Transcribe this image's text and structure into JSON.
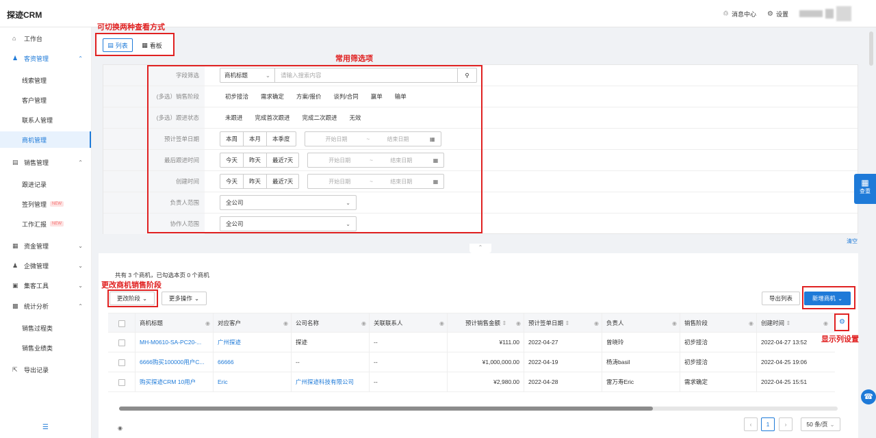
{
  "header": {
    "logo": "探迹CRM",
    "messages": "消息中心",
    "settings": "设置"
  },
  "sidebar": {
    "workbench": "工作台",
    "customer_mgmt": "客资管理",
    "lead_mgmt": "线索管理",
    "client_mgmt": "客户管理",
    "contact_mgmt": "联系人管理",
    "opportunity_mgmt": "商机管理",
    "sales_mgmt": "销售管理",
    "followup": "跟进记录",
    "contract_mgmt": "签列管理",
    "work_report": "工作汇报",
    "new_badge": "NEW",
    "fund_mgmt": "资金管理",
    "wecom_mgmt": "企微管理",
    "marketing_tools": "集客工具",
    "stats": "统计分析",
    "sales_process": "销售过程类",
    "sales_perf": "销售业绩类",
    "export_records": "导出记录"
  },
  "annotations": {
    "view_switch": "可切换两种查看方式",
    "filters": "常用筛选项",
    "change_stage": "更改商机销售阶段",
    "column_settings": "显示列设置"
  },
  "view": {
    "list": "列表",
    "board": "看板"
  },
  "filters": {
    "field_label": "字段筛选",
    "field_select": "商机标题",
    "search_placeholder": "请输入搜索内容",
    "stage_label": "(多选）销售阶段",
    "stages": [
      "初步接洽",
      "需求确定",
      "方案/报价",
      "谈判/合同",
      "赢单",
      "输单"
    ],
    "follow_label": "(多选）跟进状态",
    "follow_states": [
      "未跟进",
      "完成首次跟进",
      "完成二次跟进",
      "无效"
    ],
    "sign_date_label": "预计签单日期",
    "sign_date_btns": [
      "本周",
      "本月",
      "本季度"
    ],
    "last_follow_label": "最后跟进时间",
    "created_label": "创建时间",
    "day_btns": [
      "今天",
      "昨天",
      "最近7天"
    ],
    "start_date": "开始日期",
    "tilde": "~",
    "end_date": "结束日期",
    "owner_label": "负责人范围",
    "owner_value": "全公司",
    "collab_label": "协作人范围",
    "collab_value": "全公司",
    "clear": "清空"
  },
  "list": {
    "summary": "共有 3 个商机，已勾选本页 0 个商机",
    "change_stage_btn": "更改阶段",
    "more_btn": "更多操作",
    "export_btn": "导出列表",
    "new_btn": "新增商机",
    "columns": [
      "商机标题",
      "对应客户",
      "公司名称",
      "关联联系人",
      "预计销售金额",
      "预计签单日期",
      "负责人",
      "销售阶段",
      "创建时间"
    ],
    "rows": [
      {
        "title": "MH-M0610-SA-PC20-...",
        "client": "广州探迹",
        "company": "探迹",
        "contact": "--",
        "amount": "¥111.00",
        "date": "2022-04-27",
        "owner": "曾晓玲",
        "stage": "初步接洽",
        "created": "2022-04-27 13:52"
      },
      {
        "title": "6666购买100000用户C...",
        "client": "66666",
        "company": "--",
        "contact": "--",
        "amount": "¥1,000,000.00",
        "date": "2022-04-19",
        "owner": "杨涛basil",
        "stage": "初步接洽",
        "created": "2022-04-25 19:06"
      },
      {
        "title": "购买探迹CRM 10用户",
        "client": "Eric",
        "company": "广州探迹科技有限公司",
        "contact": "--",
        "amount": "¥2,980.00",
        "date": "2022-04-28",
        "owner": "雷万寿Eric",
        "stage": "需求确定",
        "created": "2022-04-25 15:51"
      }
    ],
    "page": "1",
    "page_size": "50 条/页"
  },
  "float": {
    "label": "查重"
  }
}
